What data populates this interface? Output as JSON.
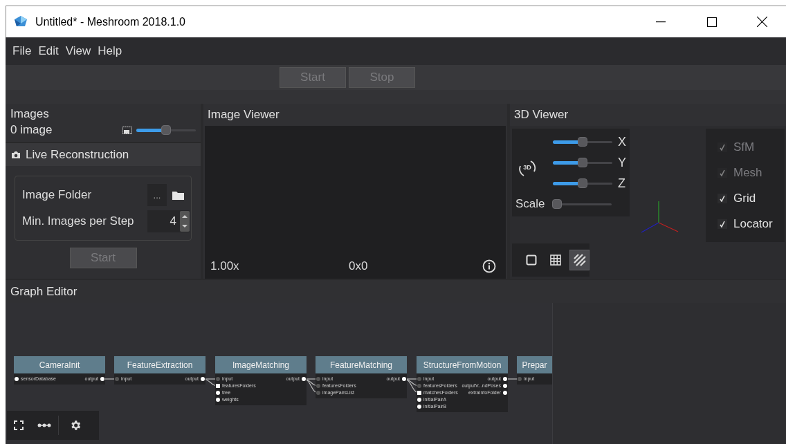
{
  "window": {
    "title": "Untitled* - Meshroom 2018.1.0"
  },
  "menu": [
    "File",
    "Edit",
    "View",
    "Help"
  ],
  "toolbar": [
    {
      "label": "Start",
      "disabled": true
    },
    {
      "label": "Stop",
      "disabled": true
    }
  ],
  "images_panel": {
    "title": "Images",
    "count": "0 image",
    "thumbnail_size": {
      "level": 0.5
    }
  },
  "live_reconstruction": {
    "title": "Live Reconstruction",
    "fields": [
      {
        "label": "Image Folder",
        "kind": "browse",
        "value": "..."
      },
      {
        "label": "Min. Images per Step",
        "kind": "spin",
        "value": "4"
      }
    ],
    "button": {
      "label": "Start",
      "disabled": true
    }
  },
  "image_viewer": {
    "title": "Image Viewer",
    "zoom": "1.00x",
    "resolution": "0x0"
  },
  "viewer_3d": {
    "title": "3D Viewer",
    "rotate_label": "3D",
    "sliders": [
      {
        "label": "X",
        "level": 0.5
      },
      {
        "label": "Y",
        "level": 0.5
      },
      {
        "label": "Z",
        "level": 0.5
      },
      {
        "label": "Scale",
        "level": 0
      }
    ],
    "layers": [
      {
        "label": "SfM",
        "checked": true,
        "disabled": true
      },
      {
        "label": "Mesh",
        "checked": true,
        "disabled": true
      },
      {
        "label": "Grid",
        "checked": true,
        "disabled": false
      },
      {
        "label": "Locator",
        "checked": true,
        "disabled": false
      }
    ],
    "view_modes": [
      {
        "kind": "solid",
        "selected": false
      },
      {
        "kind": "wireframe",
        "selected": false
      },
      {
        "kind": "textured",
        "selected": true
      }
    ]
  },
  "graph_editor": {
    "title": "Graph Editor",
    "nodes": [
      {
        "name": "CameraInit",
        "inputs": [
          {
            "label": "sensorDatabase",
            "kind": "dot",
            "linked": false
          }
        ],
        "outputs": [
          "output"
        ]
      },
      {
        "name": "FeatureExtraction",
        "inputs": [
          {
            "label": "input",
            "kind": "dot",
            "linked": true
          }
        ],
        "outputs": [
          "output"
        ]
      },
      {
        "name": "ImageMatching",
        "inputs": [
          {
            "label": "input",
            "kind": "dot",
            "linked": true
          },
          {
            "label": "featuresFolders",
            "kind": "square",
            "linked": true
          },
          {
            "label": "tree",
            "kind": "dot",
            "linked": false
          },
          {
            "label": "weights",
            "kind": "dot",
            "linked": false
          }
        ],
        "outputs": [
          "output"
        ]
      },
      {
        "name": "FeatureMatching",
        "inputs": [
          {
            "label": "input",
            "kind": "dot",
            "linked": true
          },
          {
            "label": "featuresFolders",
            "kind": "dot",
            "linked": true
          },
          {
            "label": "imagePairsList",
            "kind": "dot",
            "linked": true
          }
        ],
        "outputs": [
          "output"
        ]
      },
      {
        "name": "StructureFromMotion",
        "inputs": [
          {
            "label": "input",
            "kind": "dot",
            "linked": true
          },
          {
            "label": "featuresFolders",
            "kind": "dot",
            "linked": true
          },
          {
            "label": "matchesFolders",
            "kind": "square",
            "linked": true
          },
          {
            "label": "initialPairA",
            "kind": "dot",
            "linked": false
          },
          {
            "label": "initialPairB",
            "kind": "dot",
            "linked": false
          }
        ],
        "outputs": [
          "output",
          "outputV...ndPoses",
          "extraInfoFolder"
        ]
      },
      {
        "name": "Prepar",
        "inputs": [
          {
            "label": "input",
            "kind": "dot",
            "linked": true
          }
        ]
      }
    ]
  }
}
